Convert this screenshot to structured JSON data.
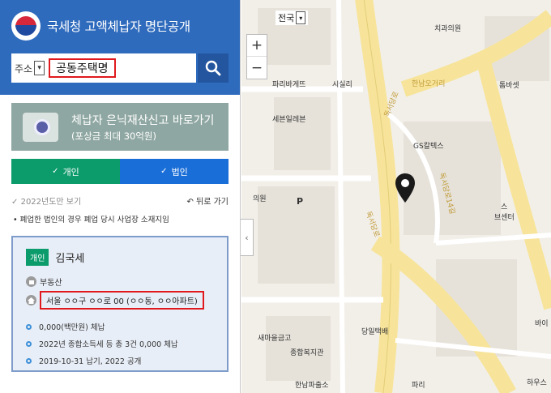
{
  "header": {
    "title": "국세청 고액체납자 명단공개"
  },
  "search": {
    "type_label": "주소",
    "value": "공동주택명"
  },
  "banner": {
    "line1": "체납자 은닉재산신고 바로가기",
    "line2": "(포상금 최대 30억원)"
  },
  "tabs": [
    {
      "label": "개인"
    },
    {
      "label": "법인"
    }
  ],
  "filter": {
    "year_label": "2022년도만 보기",
    "back_label": "뒤로 가기"
  },
  "note": "폐업한 법인의 경우 폐업 당시 사업장 소재지임",
  "card": {
    "badge": "개인",
    "name": "김국세",
    "category": "부동산",
    "address": "서울 ㅇㅇ구 ㅇㅇ로 00 (ㅇㅇ동, ㅇㅇ아파트)",
    "details": [
      "0,000(백만원) 체납",
      "2022년 종합소득세 등 총 3건 0,000 체납",
      "2019-10-31 납기, 2022 공개"
    ]
  },
  "map": {
    "region_select": "전국",
    "zoom_in": "+",
    "zoom_out": "−",
    "collapse": "‹",
    "pois": [
      "치과의원",
      "톰바셋",
      "파리바게뜨",
      "시실리",
      "세븐일레븐",
      "GS칼텍스",
      "의원",
      "P",
      "스",
      "브센터",
      "새마을금고",
      "종합복지관",
      "당일택배",
      "한남파출소",
      "파리",
      "바이",
      "하우스"
    ],
    "roads": [
      "한남오거리",
      "독서당로",
      "독서당로14길",
      "독서당로"
    ]
  },
  "colors": {
    "header": "#2f6bbd",
    "search_button": "#24559f",
    "tab_personal": "#0c9b6b",
    "tab_corporate": "#1a6ed8",
    "highlight": "#e0191e",
    "road": "#f7e49a"
  }
}
